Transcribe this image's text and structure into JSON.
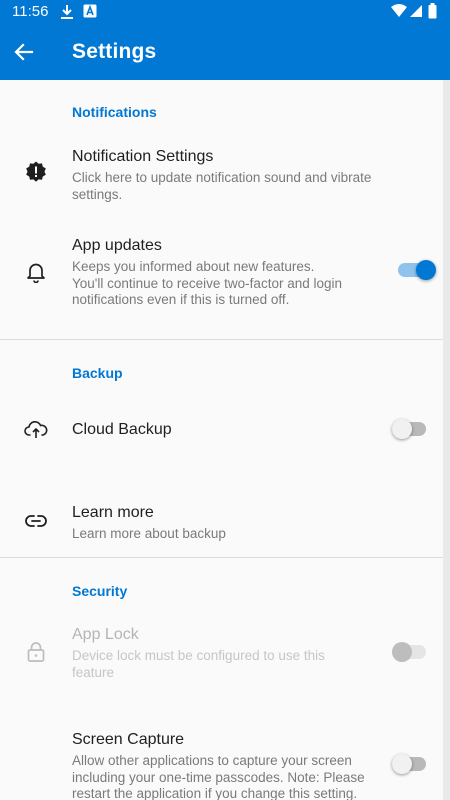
{
  "status_bar": {
    "time": "11:56",
    "icons": [
      "download-icon",
      "app-notification-icon",
      "wifi-icon",
      "signal-icon",
      "battery-icon"
    ]
  },
  "toolbar": {
    "back_icon": "arrow-back-icon",
    "title": "Settings"
  },
  "sections": {
    "notifications": {
      "header": "Notifications"
    },
    "backup": {
      "header": "Backup"
    },
    "security": {
      "header": "Security"
    }
  },
  "items": {
    "notification_settings": {
      "icon": "alert-badge-icon",
      "title": "Notification Settings",
      "subtitle_1": "Click here to update notification sound and vibrate",
      "subtitle_2": "settings."
    },
    "app_updates": {
      "icon": "bell-icon",
      "title": "App updates",
      "subtitle_1": "Keeps you informed about new features.",
      "subtitle_2": "You'll continue to receive two-factor and login",
      "subtitle_3": "notifications even if this is turned off.",
      "toggle": "on"
    },
    "cloud_backup": {
      "icon": "cloud-upload-icon",
      "title": "Cloud Backup",
      "toggle": "off"
    },
    "learn_more": {
      "icon": "link-icon",
      "title": "Learn more",
      "subtitle_1": "Learn more about backup"
    },
    "app_lock": {
      "icon": "lock-icon",
      "title": "App Lock",
      "subtitle_1": "Device lock must be configured to use this",
      "subtitle_2": "feature",
      "toggle": "off",
      "disabled": true
    },
    "screen_capture": {
      "icon": "none",
      "title": "Screen Capture",
      "subtitle_1": "Allow other applications to capture your screen",
      "subtitle_2": "including your one-time passcodes. Note: Please",
      "subtitle_3": "restart the application if you change this setting.",
      "toggle": "off"
    }
  },
  "colors": {
    "accent": "#0078d4",
    "background": "#fafafa",
    "divider": "#dcdcdc"
  }
}
